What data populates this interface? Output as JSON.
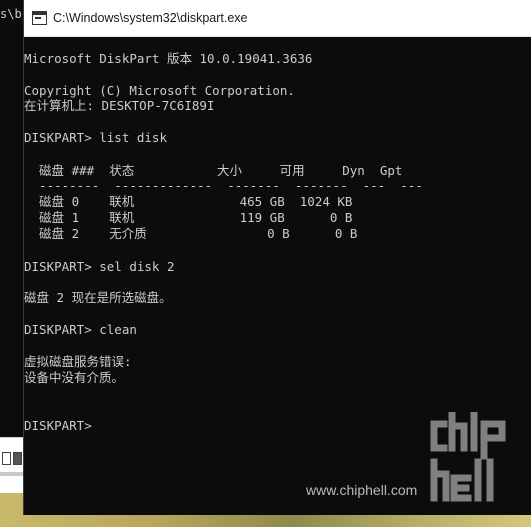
{
  "background_window": {
    "title_fragment": "s\\b"
  },
  "window": {
    "title": "C:\\Windows\\system32\\diskpart.exe"
  },
  "console": {
    "header_line": "Microsoft DiskPart 版本 10.0.19041.3636",
    "copyright_line": "Copyright (C) Microsoft Corporation.",
    "computer_line": "在计算机上: DESKTOP-7C6I89I",
    "prompt1": "DISKPART> list disk",
    "table_header": "  磁盘 ###  状态           大小     可用     Dyn  Gpt",
    "table_separator": "  --------  -------------  -------  -------  ---  ---",
    "disks": [
      "  磁盘 0    联机              465 GB  1024 KB",
      "  磁盘 1    联机              119 GB      0 B",
      "  磁盘 2    无介质                0 B      0 B"
    ],
    "prompt2": "DISKPART> sel disk 2",
    "select_result": "磁盘 2 现在是所选磁盘。",
    "prompt3": "DISKPART> clean",
    "error_line1": "虚拟磁盘服务错误:",
    "error_line2": "设备中没有介质。",
    "prompt4": "DISKPART>"
  },
  "watermark": {
    "logo_text": "chiphell",
    "site": "www.chiphell.com"
  }
}
